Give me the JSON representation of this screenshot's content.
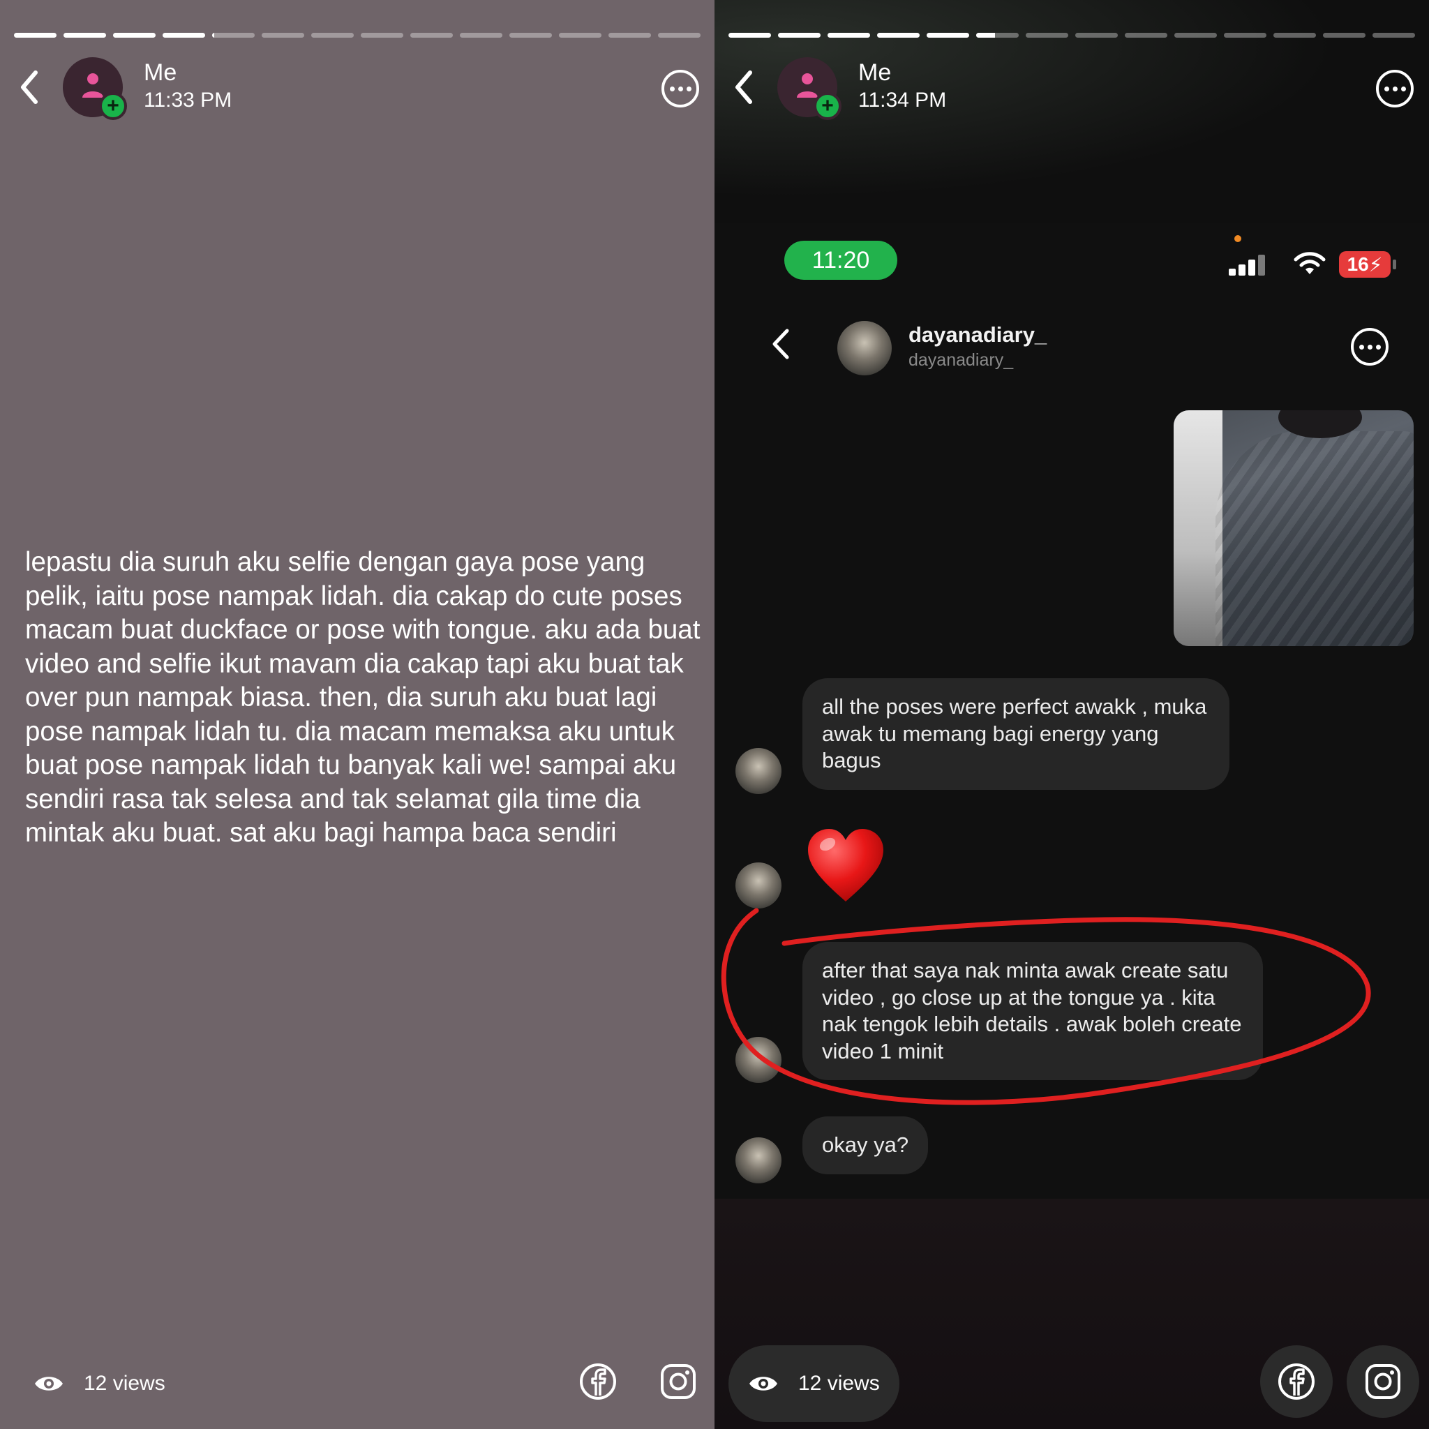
{
  "left_story": {
    "progress_total": 14,
    "progress_completed": 4,
    "progress_current_fraction": 0.05,
    "user": {
      "name": "Me",
      "time": "11:33 PM"
    },
    "text": "lepastu dia suruh aku selfie dengan gaya pose yang pelik, iaitu pose nampak lidah. dia cakap do cute poses macam buat duckface or pose with tongue. aku ada buat video and selfie ikut mavam dia cakap tapi aku buat tak over pun nampak biasa. then, dia suruh aku buat lagi pose nampak lidah tu. dia macam memaksa aku untuk buat pose nampak lidah tu banyak kali we! sampai aku sendiri rasa tak selesa and tak selamat gila time dia mintak aku buat. sat aku bagi hampa baca sendiri",
    "views": "12 views"
  },
  "right_story": {
    "progress_total": 14,
    "progress_completed": 5,
    "progress_current_fraction": 0.45,
    "user": {
      "name": "Me",
      "time": "11:34 PM"
    },
    "views": "12 views",
    "screenshot": {
      "status_time": "11:20",
      "battery": "16",
      "chat_name": "dayanadiary_",
      "chat_handle": "dayanadiary_",
      "messages": [
        "all the poses were perfect awakk , muka awak tu memang bagi energy yang bagus",
        "❤️",
        "after that saya nak minta awak create satu video , go close up at the tongue ya . kita nak tengok lebih details . awak boleh create video 1 minit",
        "okay ya?"
      ]
    }
  },
  "colors": {
    "left_bg": "#6f6469",
    "right_bg": "#101010",
    "bubble": "#262626",
    "status_green": "#22b24c",
    "battery_red": "#e63b3b",
    "annotation_red": "#e02020",
    "add_green": "#19b34a"
  },
  "icons": [
    "back-chevron-icon",
    "person-icon",
    "plus-icon",
    "more-options-icon",
    "eye-icon",
    "facebook-icon",
    "instagram-icon",
    "signal-icon",
    "wifi-icon",
    "battery-icon",
    "heart-emoji"
  ]
}
